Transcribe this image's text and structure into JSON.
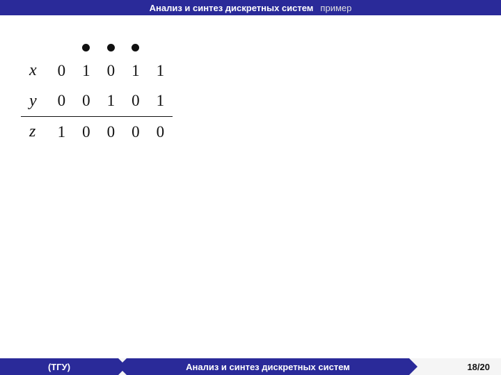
{
  "header": {
    "title": "Анализ и синтез дискретных систем",
    "subtitle": "пример"
  },
  "table": {
    "vars": [
      "x",
      "y",
      "z"
    ],
    "cols": 5,
    "dots": [
      false,
      true,
      true,
      true,
      false
    ],
    "rows": [
      [
        "0",
        "1",
        "0",
        "1",
        "1"
      ],
      [
        "0",
        "0",
        "1",
        "0",
        "1"
      ],
      [
        "1",
        "0",
        "0",
        "0",
        "0"
      ]
    ]
  },
  "footer": {
    "left": "(ТГУ)",
    "mid": "Анализ и синтез дискретных систем",
    "page_current": 18,
    "page_total": 20
  }
}
